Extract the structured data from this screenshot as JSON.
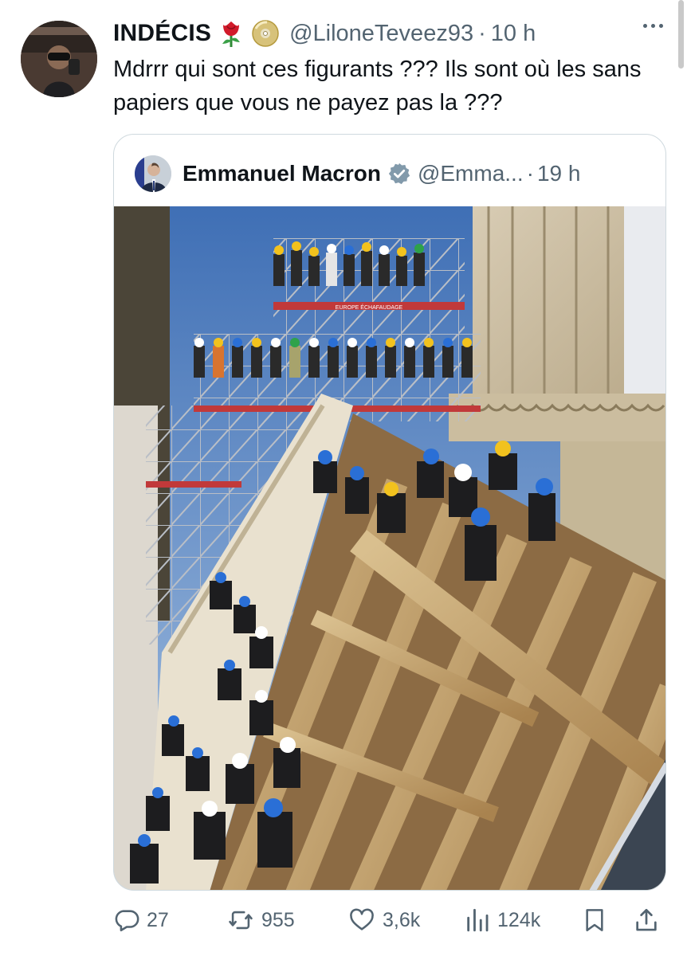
{
  "tweet": {
    "display_name": "INDÉCIS",
    "emojis": [
      "rose-emoji",
      "disc-emoji"
    ],
    "handle": "@LiloneTeveez93",
    "separator": "·",
    "time": "10 h",
    "text": "Mdrrr qui sont ces figurants ??? Ils sont où les sans papiers que vous ne payez pas la ???"
  },
  "quoted_tweet": {
    "display_name": "Emmanuel Macron",
    "verified": true,
    "handle": "@Emma...",
    "separator": "·",
    "time": "19 h",
    "scaffold_sign": "EUROPE ÉCHAFAUDAGE"
  },
  "actions": {
    "replies": "27",
    "reposts": "955",
    "likes": "3,6k",
    "views": "124k"
  },
  "icons": {
    "more": "more-icon",
    "reply": "reply-icon",
    "repost": "repost-icon",
    "like": "heart-icon",
    "views": "views-icon",
    "bookmark": "bookmark-icon",
    "share": "share-icon",
    "verified": "verified-icon"
  },
  "colors": {
    "text": "#0f1419",
    "secondary": "#536471",
    "border": "#cfd9de",
    "verified_grey": "#829aab",
    "rose": "#d11a2a"
  }
}
